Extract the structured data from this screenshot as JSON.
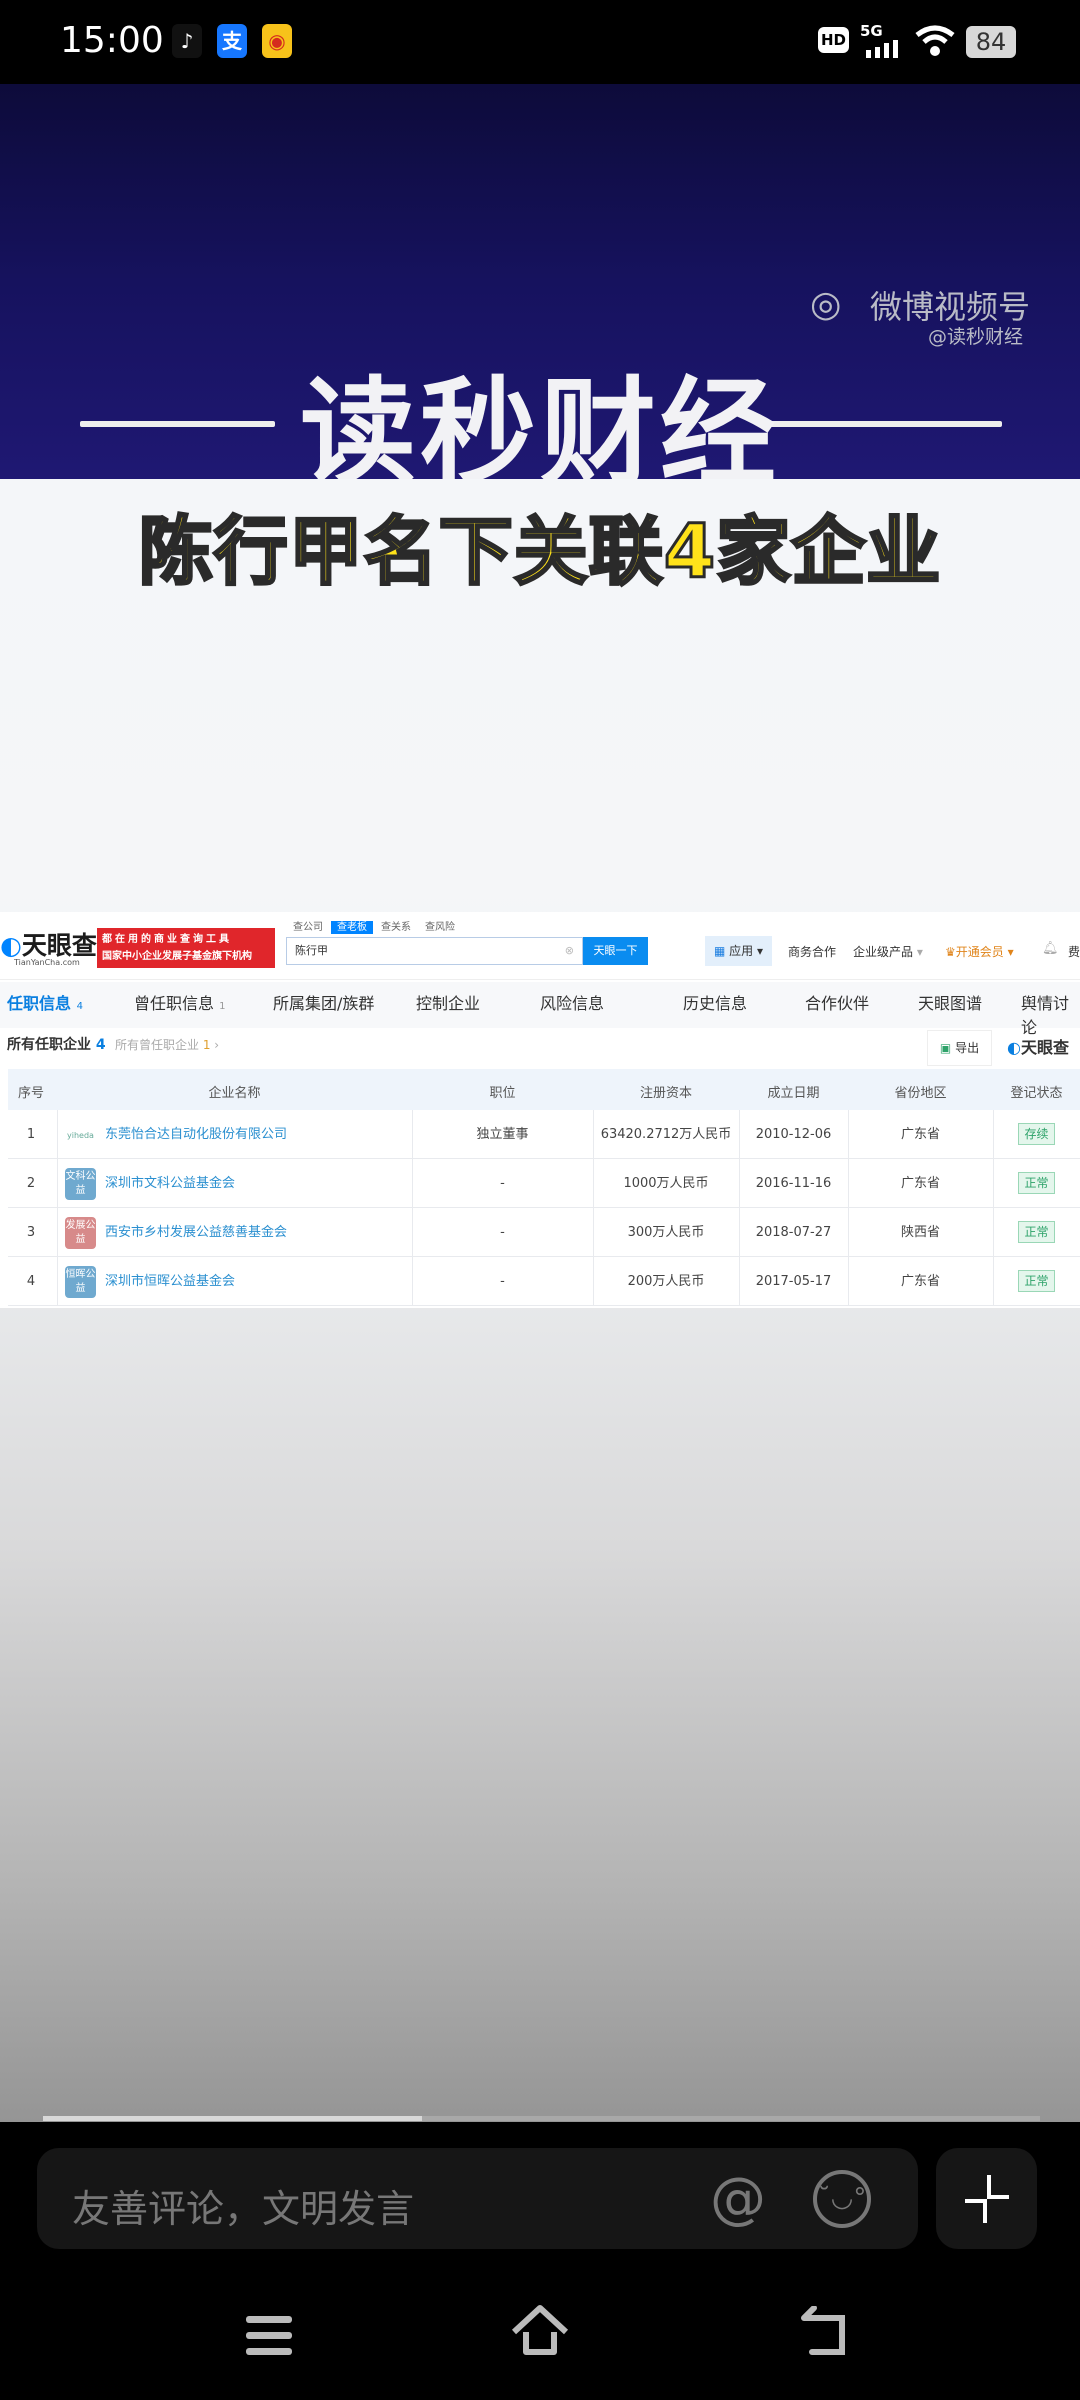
{
  "status_bar": {
    "time": "15:00",
    "apps": [
      "tiktok-icon",
      "alipay-icon",
      "weibo-icon"
    ],
    "hd": "HD",
    "network": "5G",
    "battery": "84"
  },
  "banner": {
    "title": "读秒财经",
    "watermark_platform": "微博视频号",
    "watermark_account": "@读秒财经"
  },
  "headline": "陈行甲名下关联4家企业",
  "tianyancha": {
    "logo": "天眼查",
    "logo_domain": "TianYanCha.com",
    "ad_line1": "都在用的商业查询工具",
    "ad_line2": "国家中小企业发展子基金旗下机构",
    "search_tabs": [
      "查公司",
      "查老板",
      "查关系",
      "查风险"
    ],
    "active_search_tab": 1,
    "search_value": "陈行甲",
    "search_button": "天眼一下",
    "top_nav": [
      "应用",
      "商务合作",
      "企业级产品",
      "开通会员",
      "费"
    ],
    "tabs": [
      {
        "label": "任职信息",
        "count": "4"
      },
      {
        "label": "曾任职信息",
        "count": "1"
      },
      {
        "label": "所属集团/族群"
      },
      {
        "label": "控制企业"
      },
      {
        "label": "风险信息"
      },
      {
        "label": "历史信息"
      },
      {
        "label": "合作伙伴"
      },
      {
        "label": "天眼图谱"
      },
      {
        "label": "舆情讨论"
      }
    ],
    "subheading": "所有任职企业",
    "subheading_count": "4",
    "former_link": "所有曾任职企业",
    "former_count": "1",
    "export": "导出",
    "watermark_logo": "天眼查",
    "columns": [
      "序号",
      "企业名称",
      "职位",
      "注册资本",
      "成立日期",
      "省份地区",
      "登记状态"
    ],
    "rows": [
      {
        "no": "1",
        "icon": "",
        "icon_color": "",
        "name": "东莞怡合达自动化股份有限公司",
        "position": "独立董事",
        "capital": "63420.2712万人民币",
        "date": "2010-12-06",
        "province": "广东省",
        "status": "存续"
      },
      {
        "no": "2",
        "icon": "文科公益",
        "icon_color": "#6fa9cf",
        "name": "深圳市文科公益基金会",
        "position": "-",
        "capital": "1000万人民币",
        "date": "2016-11-16",
        "province": "广东省",
        "status": "正常"
      },
      {
        "no": "3",
        "icon": "发展公益",
        "icon_color": "#d78a8a",
        "name": "西安市乡村发展公益慈善基金会",
        "position": "-",
        "capital": "300万人民币",
        "date": "2018-07-27",
        "province": "陕西省",
        "status": "正常"
      },
      {
        "no": "4",
        "icon": "恒晖公益",
        "icon_color": "#6fa9cf",
        "name": "深圳市恒晖公益基金会",
        "position": "-",
        "capital": "200万人民币",
        "date": "2017-05-17",
        "province": "广东省",
        "status": "正常"
      }
    ]
  },
  "video_progress": 0.38,
  "comment": {
    "placeholder": "友善评论，文明发言"
  }
}
